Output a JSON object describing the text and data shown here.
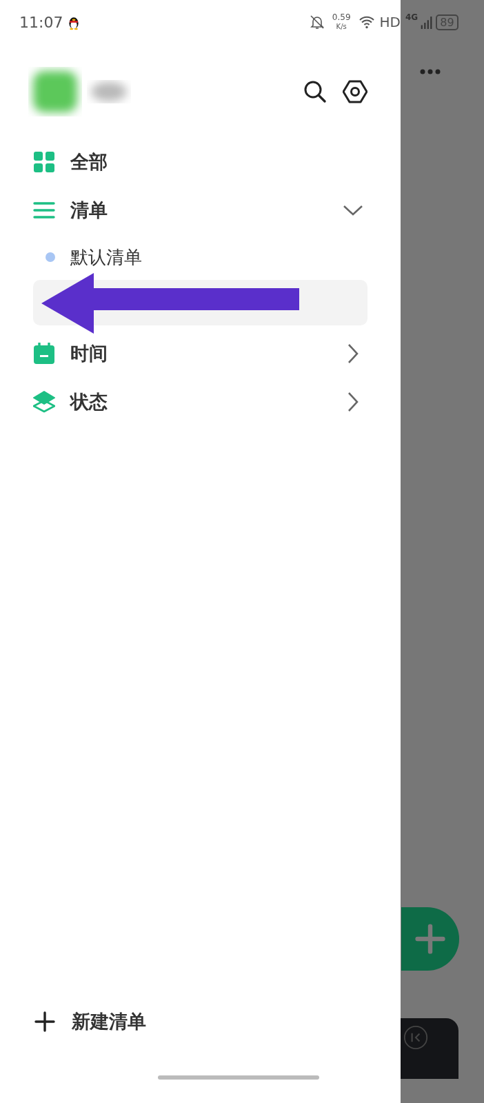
{
  "status_bar": {
    "time": "11:07",
    "speed": "0.59",
    "speed_unit": "K/s",
    "hd": "HD",
    "network": "4G",
    "battery": "89"
  },
  "menu": [
    {
      "label": "全部",
      "kind": "grid"
    },
    {
      "label": "清单",
      "kind": "lines",
      "expanded": true,
      "children": [
        {
          "kind": "list",
          "label": "默认清单",
          "color": "#a8c6f4",
          "selected": false
        },
        {
          "kind": "blank",
          "selected": true
        }
      ]
    },
    {
      "label": "时间",
      "kind": "calendar",
      "expanded": false
    },
    {
      "label": "状态",
      "kind": "layers",
      "expanded": false
    }
  ],
  "new_list": {
    "label": "新建清单"
  },
  "annotation": {
    "kind": "arrow",
    "color": "#5a2fcb"
  }
}
